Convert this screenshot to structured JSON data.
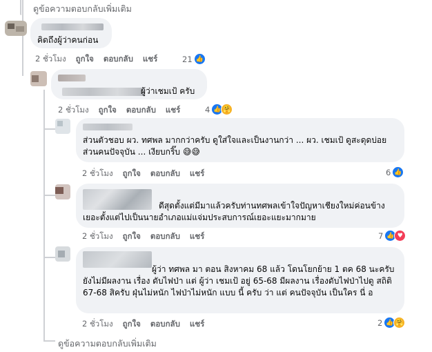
{
  "more_replies_top": "ดูข้อความตอบกลับเพิ่มเติม",
  "more_replies_bottom": "ดูข้อความตอบกลับเพิ่มเติม",
  "actions": {
    "like": "ถูกใจ",
    "reply": "ตอบกลับ",
    "share": "แชร์"
  },
  "comments": [
    {
      "text": "คิดถึงผู้ว่าคนก่อน",
      "time": "2 ชั่วโมง",
      "reaction_count": "21",
      "reactions": [
        "like-icon"
      ]
    },
    {
      "text": "ผู้ว่าเชมเป้ ครับ",
      "time": "2 ชั่วโมง",
      "reaction_count": "4",
      "reactions": [
        "like-icon",
        "care-icon"
      ]
    },
    {
      "text": "ส่วนตัวชอบ ผว. ทศพล มากกว่าครับ ดูใส่ใจและเป็นงานกว่า ... ผว. เชมเป้ ดูสะดุดบ่อย ส่วนคนปัจจุบัน ... เงียบกริ๊บ 😅😅",
      "time": "2 ชั่วโมง",
      "reaction_count": "6",
      "reactions": [
        "like-icon"
      ]
    },
    {
      "text": "ดีสุดตั้งแต่มีมาแล้วครับท่านทศพลเข้าใจปัญหาเชียงใหม่ค่อนข้างเยอะตั้งแต่ไปเป็นนายอำเภอแม่แจ่มประสบการณ์เยอะแยะมากมาย",
      "time": "2 ชั่วโมง",
      "reaction_count": "7",
      "reactions": [
        "like-icon",
        "love-icon"
      ]
    },
    {
      "text": "ผู้ว่า ทศพล มา ตอน สิงหาคม 68 แล้ว โดนโยกย้าย 1 ตค 68 นะครับ ยังไม่มีผลงาน เรื่อง ดับไฟป่า แต่ ผู้ว่า เชมเป้ อยู่ 65-68 มีผลงาน เรื่องดับไฟป่าไปดู สถิติ 67-68 สิครับ ฝุ่นไม่หนัก ไฟป่าไม่หนัก แบบ นี้ ครับ ว่า แต่ คนปัจจุบัน เป็นใคร นี่ อ",
      "time": "2 ชั่วโมง",
      "reaction_count": "2",
      "reactions": [
        "like-icon",
        "care-icon"
      ]
    }
  ],
  "colors": {
    "bubble": "#f0f2f5",
    "meta": "#65676b",
    "like": "#1877f2",
    "love": "#f33e58",
    "care": "#f7b125"
  }
}
